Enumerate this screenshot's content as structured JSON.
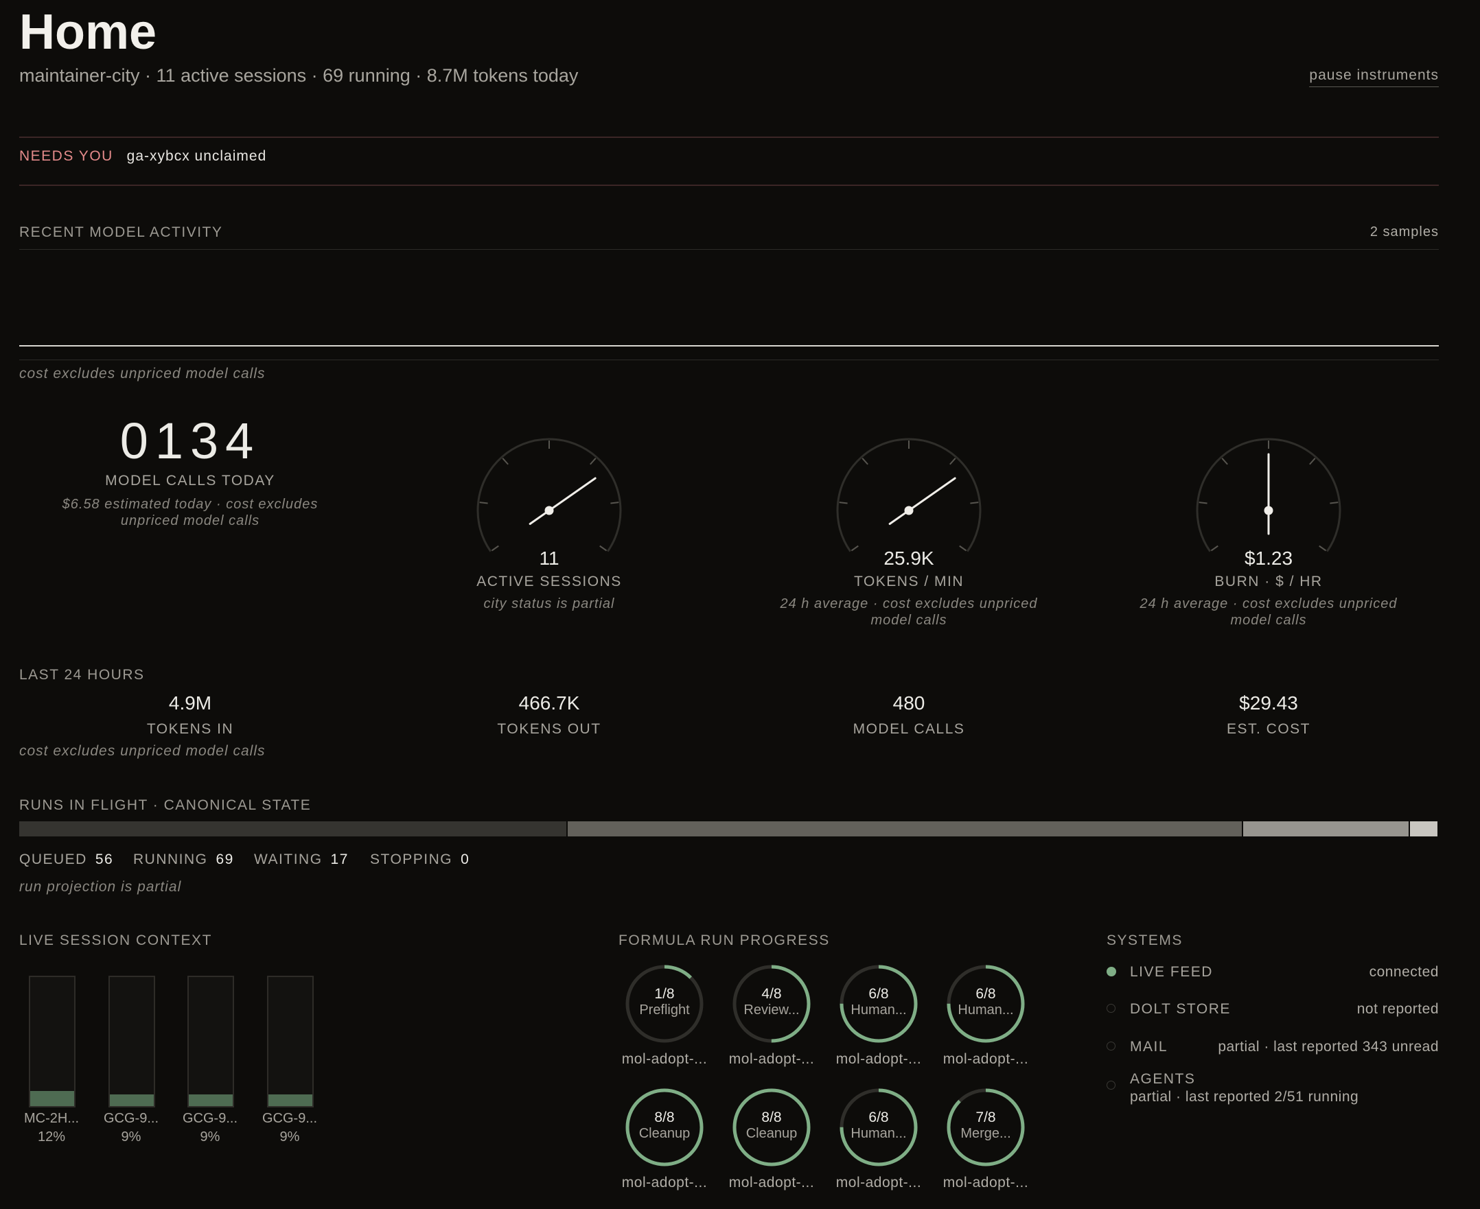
{
  "header": {
    "title": "Home",
    "subtitle": "maintainer-city · 11 active sessions · 69 running · 8.7M tokens today",
    "pause_label": "pause instruments"
  },
  "alert": {
    "label": "NEEDS YOU",
    "value": "ga-xybcx unclaimed"
  },
  "recent_activity": {
    "title": "RECENT MODEL ACTIVITY",
    "samples": "2 samples",
    "note": "cost excludes unpriced model calls"
  },
  "instruments": {
    "calls": {
      "value": "0134",
      "label": "MODEL CALLS TODAY",
      "note": "$6.58 estimated today · cost excludes unpriced model calls"
    },
    "gauges": [
      {
        "value": "11",
        "label": "ACTIVE SESSIONS",
        "note": "city status is partial",
        "level": 0.72
      },
      {
        "value": "25.9K",
        "label": "TOKENS / MIN",
        "note": "24 h average · cost excludes unpriced model calls",
        "level": 0.72
      },
      {
        "value": "$1.23",
        "label": "BURN · $ / HR",
        "note": "24 h average · cost excludes unpriced model calls",
        "level": 0.5
      }
    ]
  },
  "last24": {
    "title": "LAST 24 HOURS",
    "stats": [
      {
        "value": "4.9M",
        "label": "TOKENS IN"
      },
      {
        "value": "466.7K",
        "label": "TOKENS OUT"
      },
      {
        "value": "480",
        "label": "MODEL CALLS"
      },
      {
        "value": "$29.43",
        "label": "EST. COST"
      }
    ],
    "note": "cost excludes unpriced model calls"
  },
  "runs": {
    "title": "RUNS IN FLIGHT · CANONICAL STATE",
    "segments": [
      {
        "label": "QUEUED",
        "value": 56,
        "color": "#353430"
      },
      {
        "label": "RUNNING",
        "value": 69,
        "color": "#63615b"
      },
      {
        "label": "WAITING",
        "value": 17,
        "color": "#97958f"
      },
      {
        "label": "STOPPING",
        "value": 0,
        "color": "#c8c6c0"
      }
    ],
    "note": "run projection is partial"
  },
  "live_context": {
    "title": "LIVE SESSION CONTEXT",
    "sessions": [
      {
        "name": "MC-2H...",
        "pct": "12%",
        "fill": 0.12
      },
      {
        "name": "GCG-9...",
        "pct": "9%",
        "fill": 0.09
      },
      {
        "name": "GCG-9...",
        "pct": "9%",
        "fill": 0.09
      },
      {
        "name": "GCG-9...",
        "pct": "9%",
        "fill": 0.09
      }
    ]
  },
  "formula": {
    "title": "FORMULA RUN PROGRESS",
    "runs": [
      {
        "count": "1/8",
        "step": "Preflight",
        "name": "mol-adopt-...",
        "done": 1,
        "total": 8
      },
      {
        "count": "4/8",
        "step": "Review...",
        "name": "mol-adopt-...",
        "done": 4,
        "total": 8
      },
      {
        "count": "6/8",
        "step": "Human...",
        "name": "mol-adopt-...",
        "done": 6,
        "total": 8
      },
      {
        "count": "6/8",
        "step": "Human...",
        "name": "mol-adopt-...",
        "done": 6,
        "total": 8
      },
      {
        "count": "8/8",
        "step": "Cleanup",
        "name": "mol-adopt-...",
        "done": 8,
        "total": 8
      },
      {
        "count": "8/8",
        "step": "Cleanup",
        "name": "mol-adopt-...",
        "done": 8,
        "total": 8
      },
      {
        "count": "6/8",
        "step": "Human...",
        "name": "mol-adopt-...",
        "done": 6,
        "total": 8
      },
      {
        "count": "7/8",
        "step": "Merge...",
        "name": "mol-adopt-...",
        "done": 7,
        "total": 8
      }
    ]
  },
  "systems": {
    "title": "SYSTEMS",
    "items": [
      {
        "name": "LIVE FEED",
        "status": "connected",
        "ok": true
      },
      {
        "name": "DOLT STORE",
        "status": "not reported",
        "ok": false
      },
      {
        "name": "MAIL",
        "status": "partial · last reported 343 unread",
        "ok": false
      },
      {
        "name": "AGENTS",
        "status": "partial · last reported 2/51 running",
        "ok": false
      }
    ]
  },
  "colors": {
    "accent_green": "#7fae86",
    "alert_red": "#e38a8a",
    "background": "#0d0c0a"
  }
}
